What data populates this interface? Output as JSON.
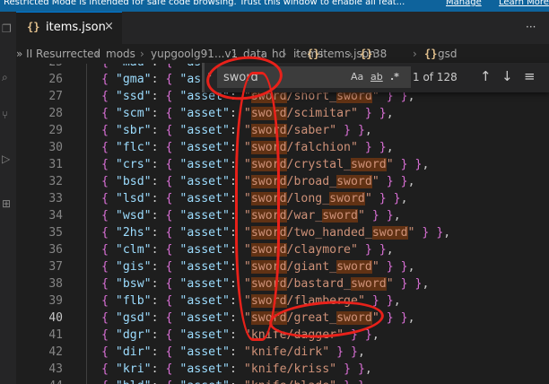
{
  "banner": {
    "message": "Restricted Mode is intended for safe code browsing. Trust this window to enable all feat...",
    "manage": "Manage",
    "learn_more": "Learn More"
  },
  "tab": {
    "icon": "{}",
    "name": "items.json",
    "close": "×",
    "more": "···"
  },
  "breadcrumb": [
    {
      "label": "» II Resurrected"
    },
    {
      "label": "mods"
    },
    {
      "label": "yupgoolg91"
    },
    {
      "label": "...v1"
    },
    {
      "label": "data"
    },
    {
      "label": "hd"
    },
    {
      "label": "items"
    },
    {
      "label": "items.json",
      "icon": "{}"
    },
    {
      "label": "38",
      "icon": "{}"
    },
    {
      "label": "gsd",
      "icon": "{}"
    }
  ],
  "find": {
    "query": "sword",
    "match_case": "Aa",
    "whole_word": "ab",
    "regex": ".*",
    "result": "1 of 128",
    "up": "↑",
    "down": "↓",
    "menu": "≡",
    "toggle": "›"
  },
  "editor": {
    "current_line": 40,
    "lines": [
      {
        "num": 25,
        "key": "mau",
        "path": "a..."
      },
      {
        "num": 26,
        "key": "gma",
        "path": "a..."
      },
      {
        "num": 27,
        "key": "ssd",
        "path": "sword/short_sword"
      },
      {
        "num": 28,
        "key": "scm",
        "path": "sword/scimitar"
      },
      {
        "num": 29,
        "key": "sbr",
        "path": "sword/saber"
      },
      {
        "num": 30,
        "key": "flc",
        "path": "sword/falchion"
      },
      {
        "num": 31,
        "key": "crs",
        "path": "sword/crystal_sword"
      },
      {
        "num": 32,
        "key": "bsd",
        "path": "sword/broad_sword"
      },
      {
        "num": 33,
        "key": "lsd",
        "path": "sword/long_sword"
      },
      {
        "num": 34,
        "key": "wsd",
        "path": "sword/war_sword"
      },
      {
        "num": 35,
        "key": "2hs",
        "path": "sword/two_handed_sword"
      },
      {
        "num": 36,
        "key": "clm",
        "path": "sword/claymore"
      },
      {
        "num": 37,
        "key": "gis",
        "path": "sword/giant_sword"
      },
      {
        "num": 38,
        "key": "bsw",
        "path": "sword/bastard_sword"
      },
      {
        "num": 39,
        "key": "flb",
        "path": "sword/flamberge"
      },
      {
        "num": 40,
        "key": "gsd",
        "path": "sword/great_sword"
      },
      {
        "num": 41,
        "key": "dgr",
        "path": "knife/dagger"
      },
      {
        "num": 42,
        "key": "dir",
        "path": "knife/dirk"
      },
      {
        "num": 43,
        "key": "kri",
        "path": "knife/kriss"
      },
      {
        "num": 44,
        "key": "bld",
        "path": "knife/blade"
      }
    ]
  },
  "colors": {
    "banner": "#0e639c",
    "match_highlight": "#ea5c00",
    "current_match_border": "#f9b94a",
    "annotation": "#e8211a"
  }
}
